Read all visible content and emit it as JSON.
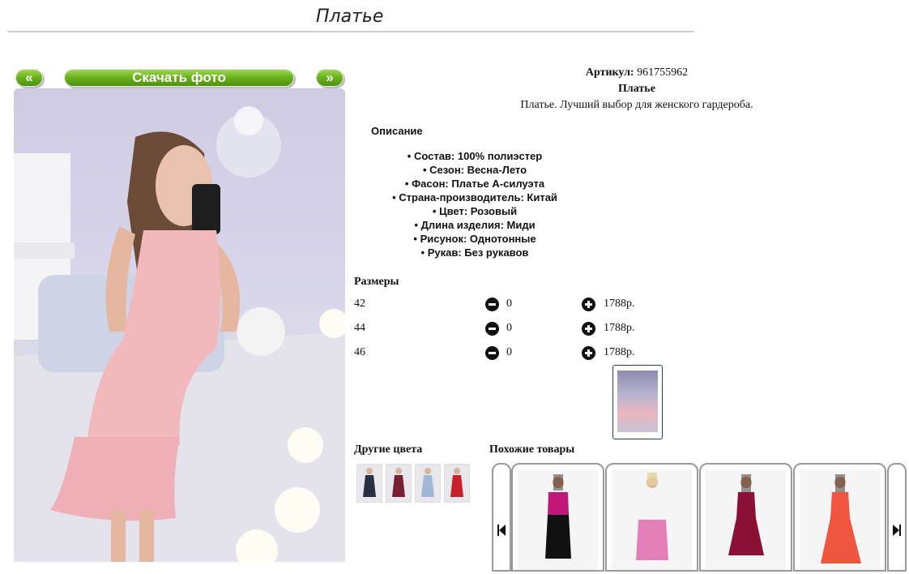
{
  "page": {
    "title": "Платье"
  },
  "gallery": {
    "prev_label": "«",
    "download_label": "Скачать фото",
    "next_label": "»"
  },
  "product": {
    "articul_label": "Артикул:",
    "articul_value": "961755962",
    "name": "Платье",
    "short_description": "Платье. Лучший выбор для женского гардероба.",
    "description_heading": "Описание",
    "features": [
      "Состав: 100% полиэстер",
      "Сезон: Весна-Лето",
      "Фасон: Платье А-силуэта",
      "Страна-производитель: Китай",
      "Цвет: Розовый",
      "Длина изделия: Миди",
      "Рисунок: Однотонные",
      "Рукав: Без рукавов"
    ]
  },
  "sizes": {
    "heading": "Размеры",
    "rows": [
      {
        "size": "42",
        "qty": "0",
        "price": "1788р."
      },
      {
        "size": "44",
        "qty": "0",
        "price": "1788р."
      },
      {
        "size": "46",
        "qty": "0",
        "price": "1788р."
      }
    ]
  },
  "other_colors": {
    "heading": "Другие цвета",
    "swatch_colors": [
      "#2a3140",
      "#7a1f33",
      "#9fb8d8",
      "#c8202a"
    ]
  },
  "similar": {
    "heading": "Похожие товары",
    "item_colors": [
      [
        "#c2187a",
        "#111111"
      ],
      [
        "#f4f4f4",
        "#e57fb8"
      ],
      [
        "#8a1036",
        "#8a1036"
      ],
      [
        "#f0553f",
        "#f0553f"
      ]
    ]
  },
  "colors": {
    "accent_green": "#6ab21c",
    "photo_pink": "#f2b9bd"
  }
}
